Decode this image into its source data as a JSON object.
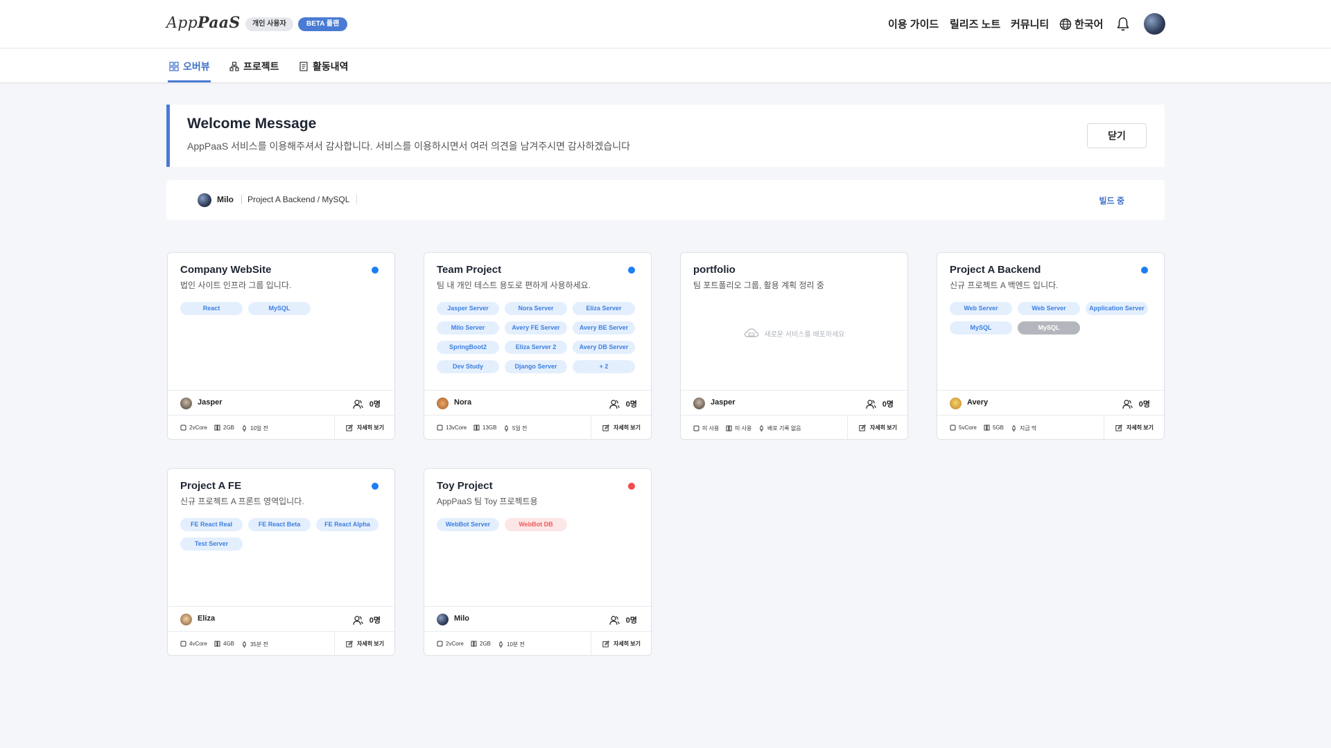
{
  "header": {
    "logo_prefix": "App",
    "logo_suffix": "PaaS",
    "user_badge": "개인 사용자",
    "beta_badge": "BETA 플랜",
    "nav": [
      "이용 가이드",
      "릴리즈 노트",
      "커뮤니티",
      "한국어"
    ],
    "icons": [
      "globe-icon",
      "bell-icon",
      "avatar"
    ]
  },
  "tabs": [
    {
      "label": "오버뷰",
      "icon": "grid-icon",
      "active": true
    },
    {
      "label": "프로젝트",
      "icon": "sitemap-icon",
      "active": false
    },
    {
      "label": "활동내역",
      "icon": "document-icon",
      "active": false
    }
  ],
  "welcome": {
    "title": "Welcome Message",
    "message": "AppPaaS 서비스를 이용해주셔서 감사합니다. 서비스를 이용하시면서 여러 의견을 남겨주시면 감사하겠습니다",
    "close_label": "닫기"
  },
  "build": {
    "user": "Milo",
    "project": "Project A Backend / MySQL",
    "status": "빌드 중"
  },
  "detail_label": "자세히 보기",
  "empty_text": "새로운 서비스를 배포하세요",
  "colors": {
    "accent": "#4a7bd4",
    "status_active": "#1c7ef2",
    "status_error": "#f24b4b"
  },
  "projects": [
    {
      "title": "Company WebSite",
      "desc": "법인 사이트 인프라 그룹 입니다.",
      "status": "active",
      "chips": [
        {
          "label": "React"
        },
        {
          "label": "MySQL"
        }
      ],
      "owner": "Jasper",
      "members": "0명",
      "cpu": "2vCore",
      "mem": "2GB",
      "deploy": "10일 전"
    },
    {
      "title": "Team Project",
      "desc": "팀 내 개인 테스트 용도로 편하게 사용하세요.",
      "status": "active",
      "chips": [
        {
          "label": "Jasper Server"
        },
        {
          "label": "Nora Server"
        },
        {
          "label": "Eliza Server"
        },
        {
          "label": "Milo Server"
        },
        {
          "label": "Avery FE Server"
        },
        {
          "label": "Avery BE Server"
        },
        {
          "label": "SpringBoot2"
        },
        {
          "label": "Eliza Server 2"
        },
        {
          "label": "Avery DB Server"
        },
        {
          "label": "Dev Study"
        },
        {
          "label": "Django Server"
        },
        {
          "label": "+ 2"
        }
      ],
      "owner": "Nora",
      "members": "0명",
      "cpu": "13vCore",
      "mem": "13GB",
      "deploy": "5일 전"
    },
    {
      "title": "portfolio",
      "desc": "팀 포트폴리오 그룹, 활용 계획 정리 중",
      "status": "none",
      "chips": [],
      "owner": "Jasper",
      "members": "0명",
      "cpu": "미 사용",
      "mem": "미 사용",
      "deploy": "배포 기록 없음"
    },
    {
      "title": "Project A Backend",
      "desc": "신규 프로젝트 A 백엔드 입니다.",
      "status": "active",
      "chips": [
        {
          "label": "Web Server"
        },
        {
          "label": "Web Server"
        },
        {
          "label": "Application Server"
        },
        {
          "label": "MySQL"
        },
        {
          "label": "MySQL",
          "style": "gray"
        }
      ],
      "owner": "Avery",
      "members": "0명",
      "cpu": "5vCore",
      "mem": "5GB",
      "deploy": "지금 막"
    },
    {
      "title": "Project A FE",
      "desc": "신규 프로젝트 A 프론트 영역입니다.",
      "status": "active",
      "chips": [
        {
          "label": "FE React Real"
        },
        {
          "label": "FE React Beta"
        },
        {
          "label": "FE React Alpha"
        },
        {
          "label": "Test Server"
        }
      ],
      "owner": "Eliza",
      "members": "0명",
      "cpu": "4vCore",
      "mem": "4GB",
      "deploy": "35분 전"
    },
    {
      "title": "Toy Project",
      "desc": "AppPaaS 팀 Toy 프로젝트용",
      "status": "error",
      "chips": [
        {
          "label": "WebBot Server"
        },
        {
          "label": "WebBot DB",
          "style": "pink"
        }
      ],
      "owner": "Milo",
      "members": "0명",
      "cpu": "2vCore",
      "mem": "2GB",
      "deploy": "10분 전"
    }
  ]
}
